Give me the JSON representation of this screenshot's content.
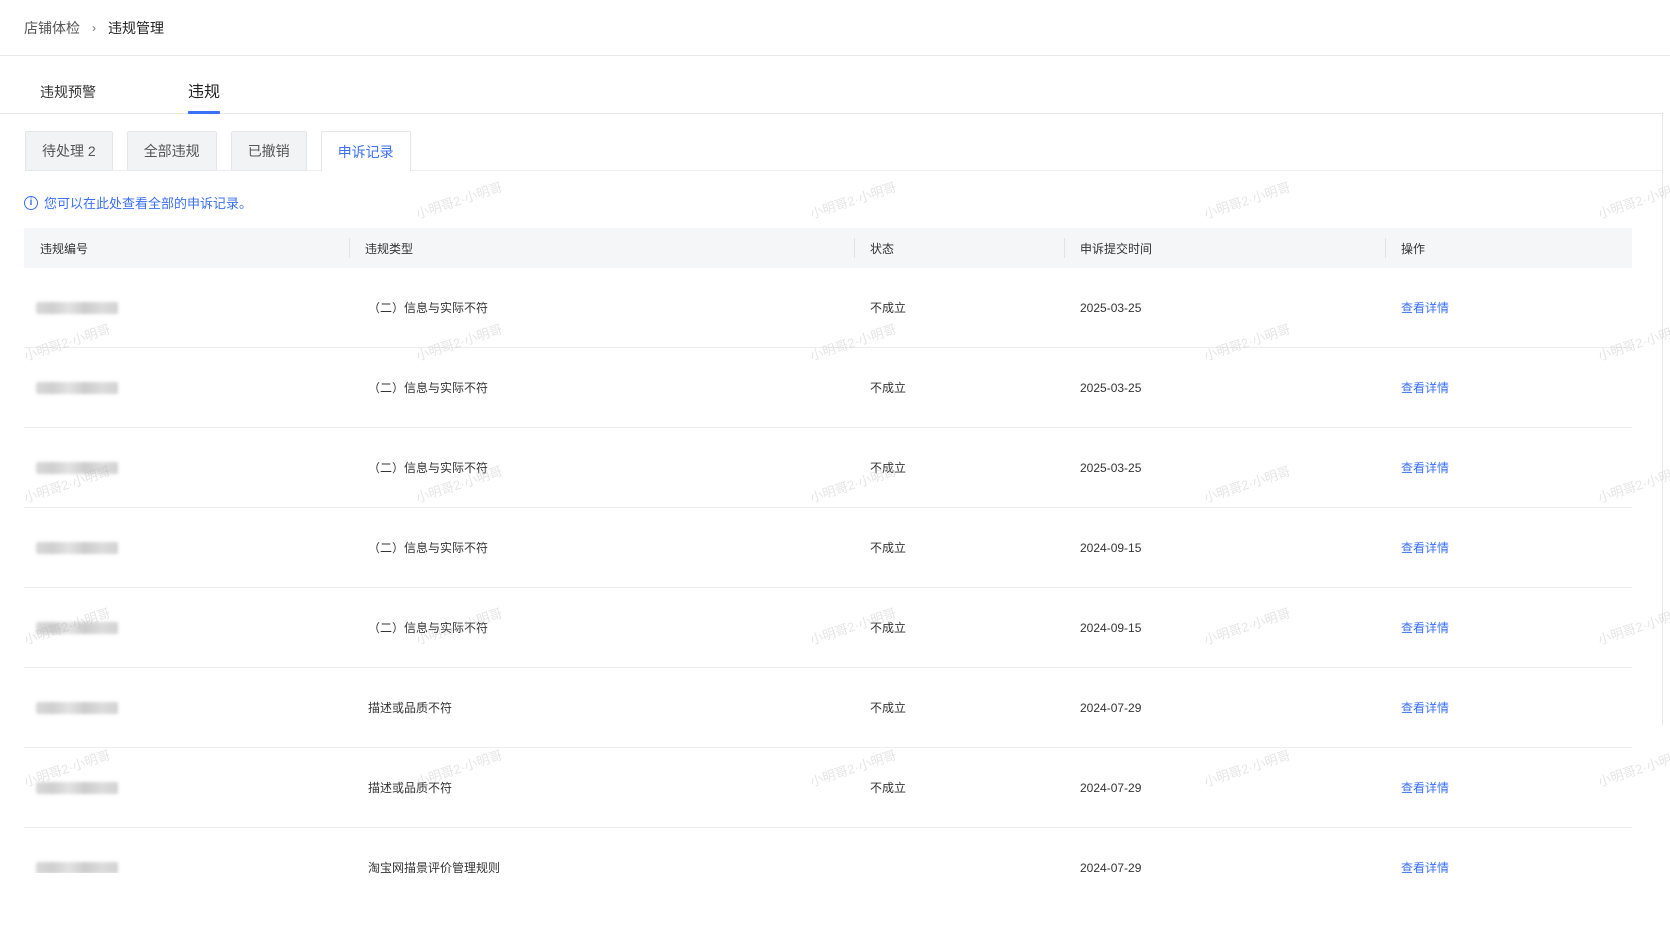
{
  "breadcrumb": {
    "parent": "店铺体检",
    "current": "违规管理"
  },
  "main_tabs": [
    {
      "label": "违规预警",
      "active": false
    },
    {
      "label": "违规",
      "active": true
    }
  ],
  "sub_tabs": [
    {
      "label": "待处理 2",
      "active": false
    },
    {
      "label": "全部违规",
      "active": false
    },
    {
      "label": "已撤销",
      "active": false
    },
    {
      "label": "申诉记录",
      "active": true
    }
  ],
  "tip": "您可以在此处查看全部的申诉记录。",
  "table": {
    "columns": [
      "违规编号",
      "违规类型",
      "状态",
      "申诉提交时间",
      "操作"
    ],
    "rows": [
      {
        "type": "（二）信息与实际不符",
        "status": "不成立",
        "time": "2025-03-25",
        "action": "查看详情"
      },
      {
        "type": "（二）信息与实际不符",
        "status": "不成立",
        "time": "2025-03-25",
        "action": "查看详情"
      },
      {
        "type": "（二）信息与实际不符",
        "status": "不成立",
        "time": "2025-03-25",
        "action": "查看详情"
      },
      {
        "type": "（二）信息与实际不符",
        "status": "不成立",
        "time": "2024-09-15",
        "action": "查看详情"
      },
      {
        "type": "（二）信息与实际不符",
        "status": "不成立",
        "time": "2024-09-15",
        "action": "查看详情"
      },
      {
        "type": "描述或品质不符",
        "status": "不成立",
        "time": "2024-07-29",
        "action": "查看详情"
      },
      {
        "type": "描述或品质不符",
        "status": "不成立",
        "time": "2024-07-29",
        "action": "查看详情"
      },
      {
        "type": "淘宝网描景评价管理规则",
        "status": "",
        "time": "2024-07-29",
        "action": "查看详情"
      }
    ]
  },
  "watermark": "小明哥2·小明哥",
  "colors": {
    "accent": "#3b6ff5",
    "header_bg": "#f5f6f8",
    "tab_bg": "#f2f3f5"
  }
}
